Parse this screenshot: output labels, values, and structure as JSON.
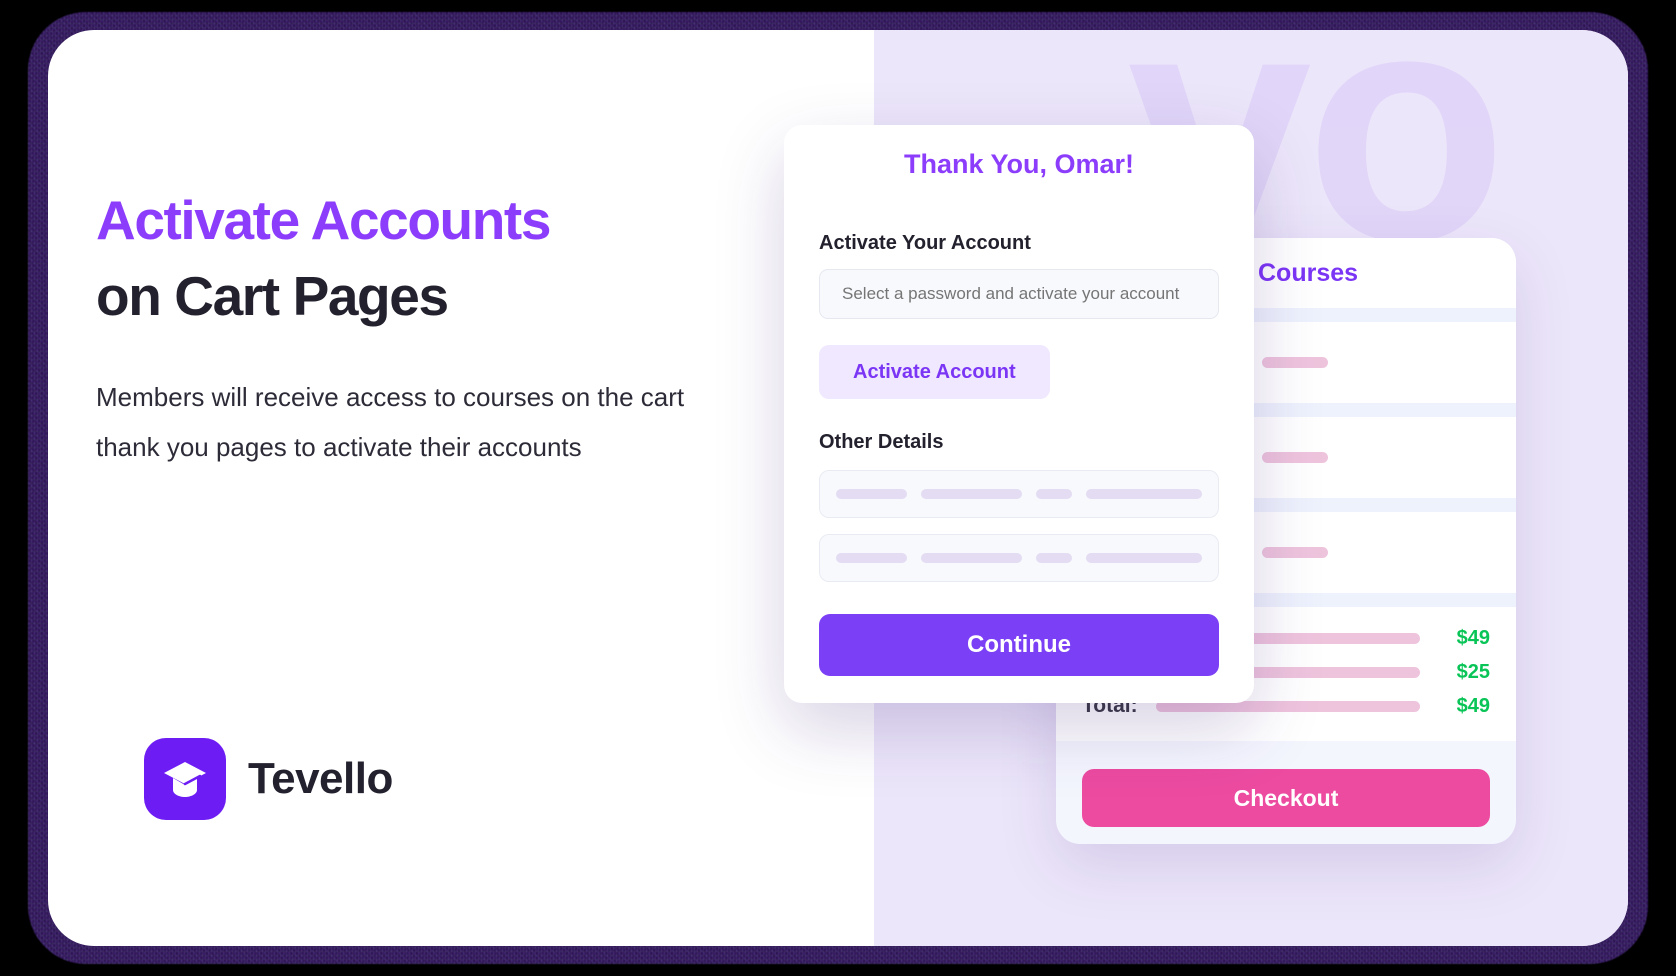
{
  "hero": {
    "title_line1": "Activate Accounts",
    "title_line2": "on Cart Pages",
    "description": "Members will receive access to courses on the cart thank you pages to activate their accounts"
  },
  "brand": {
    "name": "Tevello",
    "watermark": "vo",
    "logo_icon": "graduation-cap-icon",
    "accent_purple": "#7B3FF5",
    "accent_pink": "#EC4BA0",
    "accent_green": "#09C457"
  },
  "modal": {
    "header": "Thank You, Omar!",
    "activate_label": "Activate Your Account",
    "password_placeholder": "Select a password and activate your account",
    "password_value": "",
    "activate_button": "Activate Account",
    "other_details_label": "Other Details",
    "continue_button": "Continue"
  },
  "cart": {
    "header": "Courses",
    "rows": [
      {
        "id": "course-row-1"
      },
      {
        "id": "course-row-2"
      },
      {
        "id": "course-row-3"
      }
    ],
    "totals": [
      {
        "price": "$49"
      },
      {
        "price": "$25"
      }
    ],
    "total_label": "Total:",
    "total_price": "$49",
    "checkout_button": "Checkout"
  }
}
